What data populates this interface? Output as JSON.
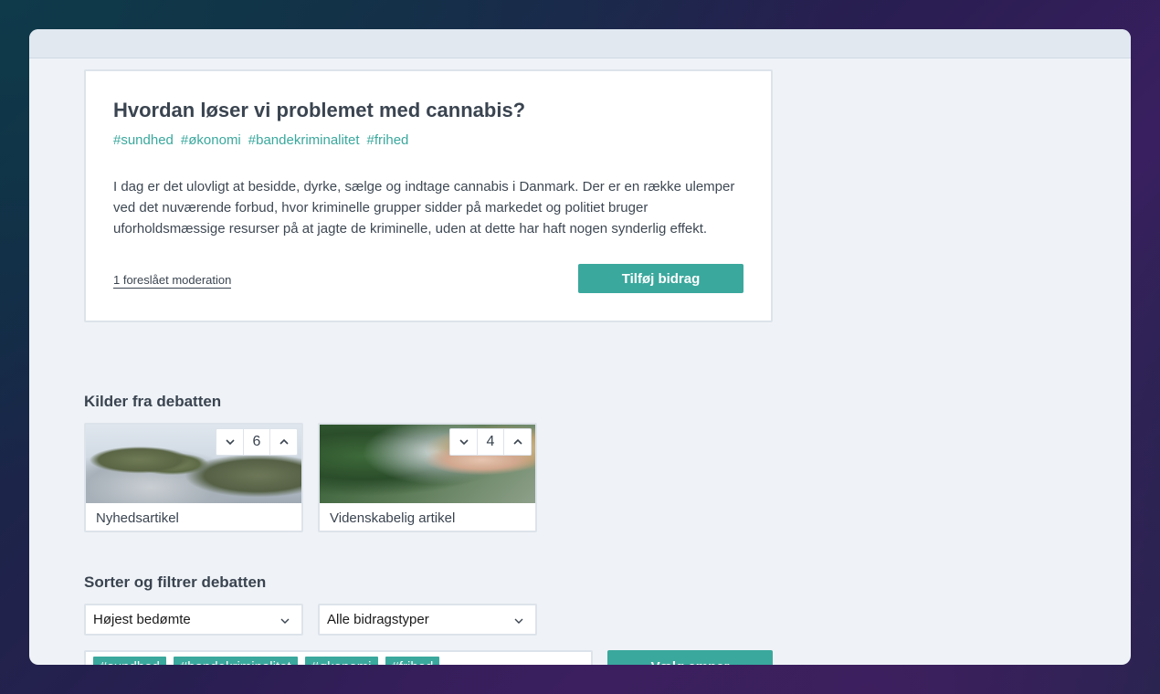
{
  "question": {
    "title": "Hvordan løser vi problemet med cannabis?",
    "tags": [
      "#sundhed",
      "#økonomi",
      "#bandekriminalitet",
      "#frihed"
    ],
    "description": "I dag er det ulovligt at besidde, dyrke, sælge og indtage cannabis i Danmark. Der er en række ulemper ved det nuværende forbud, hvor kriminelle grupper sidder på markedet og politiet bruger uforholdsmæssige resurser på at jagte de kriminelle, uden at dette har haft nogen synderlig effekt.",
    "moderation_link": "1 foreslået moderation",
    "add_button": "Tilføj bidrag"
  },
  "sources": {
    "title": "Kilder fra debatten",
    "items": [
      {
        "label": "Nyhedsartikel",
        "votes": "6"
      },
      {
        "label": "Videnskabelig artikel",
        "votes": "4"
      }
    ]
  },
  "filter": {
    "title": "Sorter og filtrer debatten",
    "sort_select": "Højest bedømte",
    "type_select": "Alle bidragstyper",
    "selected_tags": [
      "#sundhed",
      "#bandekriminalitet",
      "#økonomi",
      "#frihed"
    ],
    "choose_button": "Vælg emner"
  },
  "colors": {
    "accent": "#3aa89d",
    "text": "#3a4450",
    "page_bg": "#eff3f7"
  }
}
